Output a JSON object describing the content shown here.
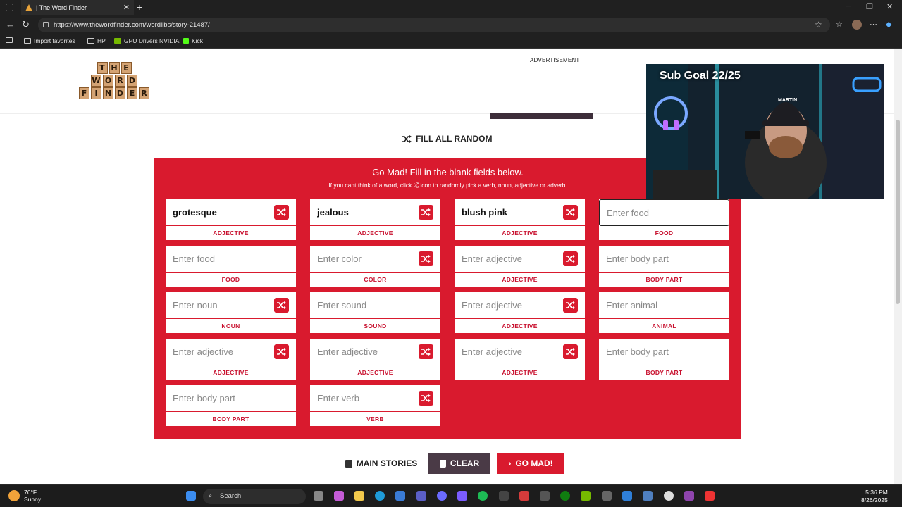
{
  "browser": {
    "tab_title": "| The Word Finder",
    "url": "https://www.thewordfinder.com/wordlibs/story-21487/",
    "bookmarks": [
      "Import favorites",
      "HP",
      "GPU Drivers NVIDIA",
      "Kick"
    ]
  },
  "header": {
    "logo_rows": [
      [
        "T",
        "H",
        "E"
      ],
      [
        "W",
        "O",
        "R",
        "D"
      ],
      [
        "F",
        "I",
        "N",
        "D",
        "E",
        "R"
      ]
    ],
    "ad_label": "ADVERTISEMENT"
  },
  "fill_random_label": "FILL ALL RANDOM",
  "panel": {
    "title": "Go Mad! Fill in the blank fields below.",
    "subtitle_pre": "If you cant think of a word, click",
    "subtitle_post": "icon to randomly pick a verb, noun, adjective or adverb.",
    "fields": [
      {
        "value": "grotesque",
        "placeholder": "",
        "label": "ADJECTIVE",
        "random": true
      },
      {
        "value": "jealous",
        "placeholder": "",
        "label": "ADJECTIVE",
        "random": true
      },
      {
        "value": "blush pink",
        "placeholder": "",
        "label": "ADJECTIVE",
        "random": true
      },
      {
        "value": "",
        "placeholder": "Enter food",
        "label": "FOOD",
        "random": false,
        "active": true
      },
      {
        "value": "",
        "placeholder": "Enter food",
        "label": "FOOD",
        "random": false
      },
      {
        "value": "",
        "placeholder": "Enter color",
        "label": "COLOR",
        "random": true
      },
      {
        "value": "",
        "placeholder": "Enter adjective",
        "label": "ADJECTIVE",
        "random": true
      },
      {
        "value": "",
        "placeholder": "Enter body part",
        "label": "BODY PART",
        "random": false
      },
      {
        "value": "",
        "placeholder": "Enter noun",
        "label": "NOUN",
        "random": true
      },
      {
        "value": "",
        "placeholder": "Enter sound",
        "label": "SOUND",
        "random": false
      },
      {
        "value": "",
        "placeholder": "Enter adjective",
        "label": "ADJECTIVE",
        "random": true
      },
      {
        "value": "",
        "placeholder": "Enter animal",
        "label": "ANIMAL",
        "random": false
      },
      {
        "value": "",
        "placeholder": "Enter adjective",
        "label": "ADJECTIVE",
        "random": true
      },
      {
        "value": "",
        "placeholder": "Enter adjective",
        "label": "ADJECTIVE",
        "random": true
      },
      {
        "value": "",
        "placeholder": "Enter adjective",
        "label": "ADJECTIVE",
        "random": true
      },
      {
        "value": "",
        "placeholder": "Enter body part",
        "label": "BODY PART",
        "random": false
      },
      {
        "value": "",
        "placeholder": "Enter body part",
        "label": "BODY PART",
        "random": false
      },
      {
        "value": "",
        "placeholder": "Enter verb",
        "label": "VERB",
        "random": true
      }
    ]
  },
  "actions": {
    "main_stories": "MAIN STORIES",
    "clear": "CLEAR",
    "go_mad": "GO MAD!"
  },
  "overlay": {
    "sub_goal": "Sub Goal 22/25",
    "cap_text": "MARTIN"
  },
  "taskbar": {
    "temperature": "76°F",
    "condition": "Sunny",
    "search": "Search",
    "time": "5:36 PM",
    "date": "8/26/2025"
  },
  "colors": {
    "accent_red": "#d91a2e",
    "clear_button": "#4a3a46",
    "browser_dark": "#202020"
  }
}
